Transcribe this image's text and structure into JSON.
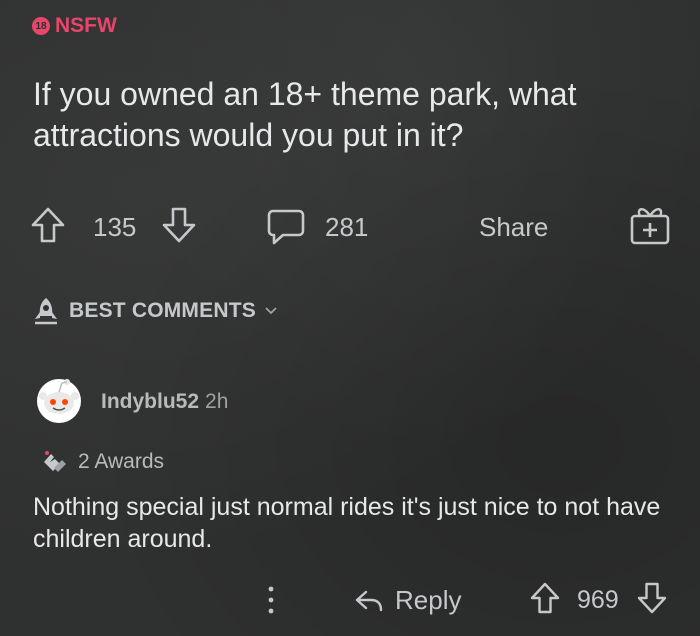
{
  "post": {
    "nsfw_badge": "18",
    "nsfw_label": "NSFW",
    "title": "If you owned an 18+ theme park, what attractions would you put in it?",
    "score": "135",
    "comment_count": "281",
    "share_label": "Share"
  },
  "comments_section": {
    "sort_label": "BEST COMMENTS"
  },
  "comment": {
    "username": "Indyblu52",
    "time": "2h",
    "awards_label": "2 Awards",
    "body": "Nothing special just normal rides it's just nice to not have children around.",
    "reply_label": "Reply",
    "more_glyph": "⋮",
    "score": "969"
  },
  "colors": {
    "nsfw": "#e8456a",
    "background": "#2f3030",
    "text": "#e6e8ea",
    "muted": "#c6c9cb"
  }
}
